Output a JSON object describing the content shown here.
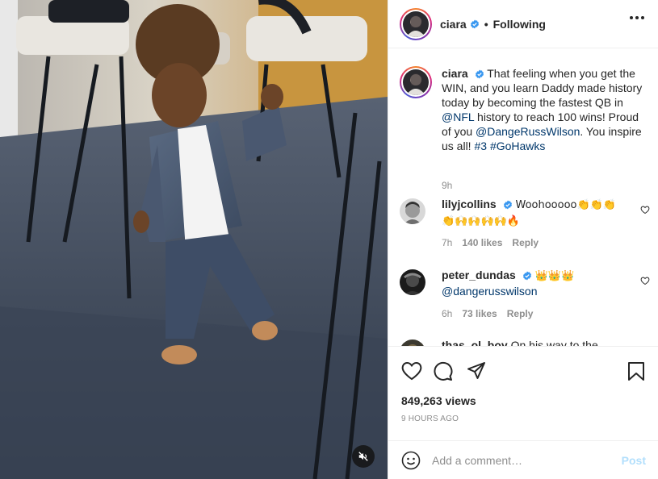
{
  "post": {
    "username": "ciara",
    "follow_state": "Following",
    "separator": "•"
  },
  "caption": {
    "username": "ciara",
    "text_1": "That feeling when you get the WIN, and you learn Daddy made history today by becoming the fastest QB in ",
    "mention_nfl": "@NFL",
    "text_2": " history to reach 100 wins! Proud of you ",
    "mention_russ": "@DangeRussWilson",
    "text_3": ". You inspire us all! ",
    "hashtag_3": "#3",
    "hashtag_gohawks": "#GoHawks",
    "time": "9h"
  },
  "comments": [
    {
      "username": "lilyjcollins",
      "text": "Woohooooo👏👏👏 👏🙌🙌🙌🙌🔥",
      "time": "7h",
      "likes": "140 likes",
      "reply": "Reply"
    },
    {
      "username": "peter_dundas",
      "text": "👑👑👑",
      "mention": "@dangerusswilson",
      "time": "6h",
      "likes": "73 likes",
      "reply": "Reply"
    },
    {
      "username": "thas_ol_boy",
      "text": "On his way to the"
    }
  ],
  "stats": {
    "views": "849,263 views",
    "date": "9 HOURS AGO"
  },
  "add_comment": {
    "placeholder": "Add a comment…",
    "post_label": "Post"
  },
  "icons": {
    "more": "more-options-icon",
    "heart": "heart-icon",
    "comment": "comment-icon",
    "share": "share-icon",
    "save": "bookmark-icon",
    "emoji": "emoji-icon",
    "mute": "speaker-muted-icon",
    "verified": "verified-badge-icon"
  },
  "colors": {
    "verified": "#3897f0",
    "link": "#00376b",
    "muted_text": "#8e8e8e",
    "post_disabled": "#b2dffc"
  }
}
